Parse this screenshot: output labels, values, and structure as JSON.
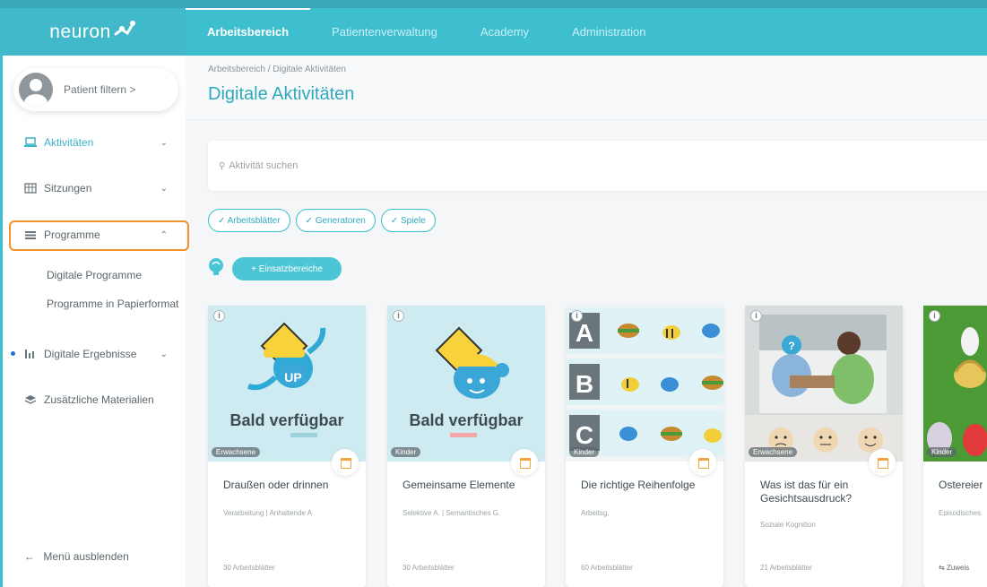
{
  "app": {
    "logo_text": "neuron"
  },
  "nav": {
    "items": [
      "Arbeitsbereich",
      "Patientenverwaltung",
      "Academy",
      "Administration"
    ]
  },
  "sidebar": {
    "patient_filter": "Patient filtern  >",
    "items": [
      {
        "label": "Aktivitäten",
        "icon": "laptop-icon"
      },
      {
        "label": "Sitzungen",
        "icon": "grid-icon"
      },
      {
        "label": "Programme",
        "icon": "list-icon"
      },
      {
        "label": "Digitale Ergebnisse",
        "icon": "bar-chart-icon"
      },
      {
        "label": "Zusätzliche Materialien",
        "icon": "layers-icon"
      }
    ],
    "sub_items": [
      "Digitale Programme",
      "Programme in Papierformat"
    ],
    "hide_menu": "Menü ausblenden"
  },
  "main": {
    "breadcrumb": "Arbeitsbereich  /  Digitale Aktivitäten",
    "title": "Digitale Aktivitäten",
    "search_placeholder": "Aktivität suchen",
    "chips": [
      "✓ Arbeitsblätter",
      "✓ Generatoren",
      "✓ Spiele"
    ],
    "einsatz_button": "+ Einsatzbereiche",
    "cards": [
      {
        "title": "Draußen oder drinnen",
        "sub": "Verarbeitung | Anhaltende A",
        "count": "30 Arbeitsblätter",
        "tag": "Erwachsene",
        "overlay": "Bald verfügbar"
      },
      {
        "title": "Gemeinsame Elemente",
        "sub": "Selektive A. | Semantisches G.",
        "count": "30 Arbeitsblätter",
        "tag": "Kinder",
        "overlay": "Bald verfügbar"
      },
      {
        "title": "Die richtige Reihenfolge",
        "sub": "Arbeitsg.",
        "count": "60 Arbeitsblätter",
        "tag": "Kinder",
        "overlay": ""
      },
      {
        "title": "Was ist das für ein Gesichtsausdruck?",
        "sub": "Soziale Kognition",
        "count": "21 Arbeitsblätter",
        "tag": "Erwachsene",
        "overlay": ""
      },
      {
        "title": "Ostereier",
        "sub": "Episodisches",
        "count": "Zuweis",
        "tag": "Kinder",
        "overlay": ""
      }
    ]
  },
  "colors": {
    "accent": "#3dbfd0",
    "highlight": "#f2922a"
  }
}
